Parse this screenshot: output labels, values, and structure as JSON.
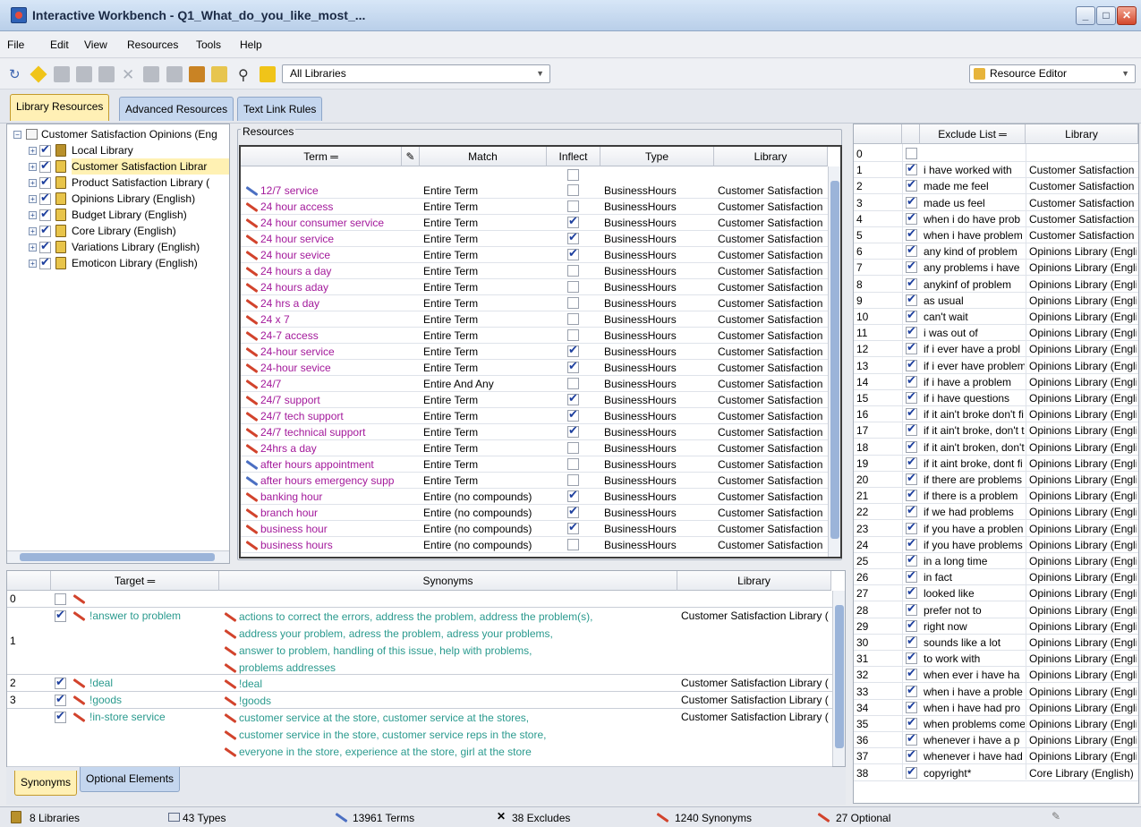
{
  "window": {
    "title": "Interactive Workbench - Q1_What_do_you_like_most_..."
  },
  "menu": [
    "File",
    "Edit",
    "View",
    "Resources",
    "Tools",
    "Help"
  ],
  "toolbar": {
    "library_filter": "All Libraries",
    "editor_select": "Resource Editor"
  },
  "main_tabs": [
    "Library Resources",
    "Advanced Resources",
    "Text Link Rules"
  ],
  "tree": {
    "root": "Customer Satisfaction Opinions (Eng",
    "items": [
      "Local Library",
      "Customer Satisfaction Librar",
      "Product Satisfaction Library (",
      "Opinions Library (English)",
      "Budget Library (English)",
      "Core Library (English)",
      "Variations Library (English)",
      "Emoticon Library (English)"
    ]
  },
  "resources": {
    "group_label": "Resources",
    "columns": [
      "Term",
      "Match",
      "Inflect",
      "Type",
      "Library"
    ],
    "rows": [
      {
        "term": "12/7 service",
        "match": "Entire Term",
        "inflect": false,
        "type": "BusinessHours",
        "library": "Customer Satisfaction",
        "icon": "blue"
      },
      {
        "term": "24 hour access",
        "match": "Entire Term",
        "inflect": false,
        "type": "BusinessHours",
        "library": "Customer Satisfaction",
        "icon": "red"
      },
      {
        "term": "24 hour consumer service",
        "match": "Entire Term",
        "inflect": true,
        "type": "BusinessHours",
        "library": "Customer Satisfaction",
        "icon": "red"
      },
      {
        "term": "24 hour service",
        "match": "Entire Term",
        "inflect": true,
        "type": "BusinessHours",
        "library": "Customer Satisfaction",
        "icon": "red"
      },
      {
        "term": "24 hour sevice",
        "match": "Entire Term",
        "inflect": true,
        "type": "BusinessHours",
        "library": "Customer Satisfaction",
        "icon": "red"
      },
      {
        "term": "24 hours a day",
        "match": "Entire Term",
        "inflect": false,
        "type": "BusinessHours",
        "library": "Customer Satisfaction",
        "icon": "red"
      },
      {
        "term": "24 hours aday",
        "match": "Entire Term",
        "inflect": false,
        "type": "BusinessHours",
        "library": "Customer Satisfaction",
        "icon": "red"
      },
      {
        "term": "24 hrs a day",
        "match": "Entire Term",
        "inflect": false,
        "type": "BusinessHours",
        "library": "Customer Satisfaction",
        "icon": "red"
      },
      {
        "term": "24 x 7",
        "match": "Entire Term",
        "inflect": false,
        "type": "BusinessHours",
        "library": "Customer Satisfaction",
        "icon": "red"
      },
      {
        "term": "24-7 access",
        "match": "Entire Term",
        "inflect": false,
        "type": "BusinessHours",
        "library": "Customer Satisfaction",
        "icon": "red"
      },
      {
        "term": "24-hour service",
        "match": "Entire Term",
        "inflect": true,
        "type": "BusinessHours",
        "library": "Customer Satisfaction",
        "icon": "red"
      },
      {
        "term": "24-hour sevice",
        "match": "Entire Term",
        "inflect": true,
        "type": "BusinessHours",
        "library": "Customer Satisfaction",
        "icon": "red"
      },
      {
        "term": "24/7",
        "match": "Entire And Any",
        "inflect": false,
        "type": "BusinessHours",
        "library": "Customer Satisfaction",
        "icon": "red"
      },
      {
        "term": "24/7 support",
        "match": "Entire Term",
        "inflect": true,
        "type": "BusinessHours",
        "library": "Customer Satisfaction",
        "icon": "red"
      },
      {
        "term": "24/7 tech support",
        "match": "Entire Term",
        "inflect": true,
        "type": "BusinessHours",
        "library": "Customer Satisfaction",
        "icon": "red"
      },
      {
        "term": "24/7 technical support",
        "match": "Entire Term",
        "inflect": true,
        "type": "BusinessHours",
        "library": "Customer Satisfaction",
        "icon": "red"
      },
      {
        "term": "24hrs a day",
        "match": "Entire Term",
        "inflect": false,
        "type": "BusinessHours",
        "library": "Customer Satisfaction",
        "icon": "red"
      },
      {
        "term": "after hours appointment",
        "match": "Entire Term",
        "inflect": false,
        "type": "BusinessHours",
        "library": "Customer Satisfaction",
        "icon": "blue"
      },
      {
        "term": "after hours emergency supp",
        "match": "Entire Term",
        "inflect": false,
        "type": "BusinessHours",
        "library": "Customer Satisfaction",
        "icon": "blue"
      },
      {
        "term": "banking hour",
        "match": "Entire (no compounds)",
        "inflect": true,
        "type": "BusinessHours",
        "library": "Customer Satisfaction",
        "icon": "red"
      },
      {
        "term": "branch hour",
        "match": "Entire (no compounds)",
        "inflect": true,
        "type": "BusinessHours",
        "library": "Customer Satisfaction",
        "icon": "red"
      },
      {
        "term": "business hour",
        "match": "Entire (no compounds)",
        "inflect": true,
        "type": "BusinessHours",
        "library": "Customer Satisfaction",
        "icon": "red"
      },
      {
        "term": "business hours",
        "match": "Entire (no compounds)",
        "inflect": false,
        "type": "BusinessHours",
        "library": "Customer Satisfaction",
        "icon": "red"
      }
    ]
  },
  "synonyms": {
    "columns": [
      "Target",
      "Synonyms",
      "Library"
    ],
    "rows": [
      {
        "num": "0",
        "target": "",
        "lines": [],
        "library": ""
      },
      {
        "num": "1",
        "target": "!answer to problem",
        "lines": [
          "actions to correct the errors,   address the problem,   address the problem(s),",
          "address your problem,   adress the problem,   adress your problems,",
          "answer to problem,   handling of this issue,   help with problems,",
          "problems addresses"
        ],
        "library": "Customer Satisfaction Library ("
      },
      {
        "num": "2",
        "target": "!deal",
        "lines": [
          "!deal"
        ],
        "library": "Customer Satisfaction Library ("
      },
      {
        "num": "3",
        "target": "!goods",
        "lines": [
          "!goods"
        ],
        "library": "Customer Satisfaction Library ("
      },
      {
        "num": "",
        "target": "!in-store service",
        "lines": [
          "customer service at the store,   customer service at the stores,",
          "customer service in the store,   customer service reps in the store,",
          "everyone in the store,   experience at the store,   girl at the store"
        ],
        "library": "Customer Satisfaction Library ("
      }
    ]
  },
  "bottom_tabs": [
    "Synonyms",
    "Optional Elements"
  ],
  "exclude": {
    "columns": [
      "Exclude List",
      "Library"
    ],
    "rows": [
      {
        "n": "0",
        "text": "",
        "lib": "",
        "on": false
      },
      {
        "n": "1",
        "text": "i have worked with",
        "lib": "Customer Satisfaction",
        "on": true
      },
      {
        "n": "2",
        "text": "made me feel",
        "lib": "Customer Satisfaction",
        "on": true
      },
      {
        "n": "3",
        "text": "made us feel",
        "lib": "Customer Satisfaction",
        "on": true
      },
      {
        "n": "4",
        "text": "when i do have prob",
        "lib": "Customer Satisfaction",
        "on": true
      },
      {
        "n": "5",
        "text": "when i have problem",
        "lib": "Customer Satisfaction",
        "on": true
      },
      {
        "n": "6",
        "text": "any kind of problem",
        "lib": "Opinions Library (Engli",
        "on": true
      },
      {
        "n": "7",
        "text": "any problems i have",
        "lib": "Opinions Library (Engli",
        "on": true
      },
      {
        "n": "8",
        "text": "anykinf of problem",
        "lib": "Opinions Library (Engli",
        "on": true
      },
      {
        "n": "9",
        "text": "as usual",
        "lib": "Opinions Library (Engli",
        "on": true
      },
      {
        "n": "10",
        "text": "can't wait",
        "lib": "Opinions Library (Engli",
        "on": true
      },
      {
        "n": "11",
        "text": "i was out of",
        "lib": "Opinions Library (Engli",
        "on": true
      },
      {
        "n": "12",
        "text": "if i ever have a probl",
        "lib": "Opinions Library (Engli",
        "on": true
      },
      {
        "n": "13",
        "text": "if i ever have problem",
        "lib": "Opinions Library (Engli",
        "on": true
      },
      {
        "n": "14",
        "text": "if i have a problem",
        "lib": "Opinions Library (Engli",
        "on": true
      },
      {
        "n": "15",
        "text": "if i have questions",
        "lib": "Opinions Library (Engli",
        "on": true
      },
      {
        "n": "16",
        "text": "if it ain't broke don't fi",
        "lib": "Opinions Library (Engli",
        "on": true
      },
      {
        "n": "17",
        "text": "if it ain't broke, don't t",
        "lib": "Opinions Library (Engli",
        "on": true
      },
      {
        "n": "18",
        "text": "if it ain't broken, don't",
        "lib": "Opinions Library (Engli",
        "on": true
      },
      {
        "n": "19",
        "text": "if it aint broke, dont fi",
        "lib": "Opinions Library (Engli",
        "on": true
      },
      {
        "n": "20",
        "text": "if there are problems",
        "lib": "Opinions Library (Engli",
        "on": true
      },
      {
        "n": "21",
        "text": "if there is a problem",
        "lib": "Opinions Library (Engli",
        "on": true
      },
      {
        "n": "22",
        "text": "if we had problems",
        "lib": "Opinions Library (Engli",
        "on": true
      },
      {
        "n": "23",
        "text": "if you have a problen",
        "lib": "Opinions Library (Engli",
        "on": true
      },
      {
        "n": "24",
        "text": "if you have problems",
        "lib": "Opinions Library (Engli",
        "on": true
      },
      {
        "n": "25",
        "text": "in a long time",
        "lib": "Opinions Library (Engli",
        "on": true
      },
      {
        "n": "26",
        "text": "in fact",
        "lib": "Opinions Library (Engli",
        "on": true
      },
      {
        "n": "27",
        "text": "looked like",
        "lib": "Opinions Library (Engli",
        "on": true
      },
      {
        "n": "28",
        "text": "prefer not to",
        "lib": "Opinions Library (Engli",
        "on": true
      },
      {
        "n": "29",
        "text": "right now",
        "lib": "Opinions Library (Engli",
        "on": true
      },
      {
        "n": "30",
        "text": "sounds like a lot",
        "lib": "Opinions Library (Engli",
        "on": true
      },
      {
        "n": "31",
        "text": "to work with",
        "lib": "Opinions Library (Engli",
        "on": true
      },
      {
        "n": "32",
        "text": "when ever i have ha",
        "lib": "Opinions Library (Engli",
        "on": true
      },
      {
        "n": "33",
        "text": "when i have a proble",
        "lib": "Opinions Library (Engli",
        "on": true
      },
      {
        "n": "34",
        "text": "when i have had pro",
        "lib": "Opinions Library (Engli",
        "on": true
      },
      {
        "n": "35",
        "text": "when problems come",
        "lib": "Opinions Library (Engli",
        "on": true
      },
      {
        "n": "36",
        "text": "whenever i have a p",
        "lib": "Opinions Library (Engli",
        "on": true
      },
      {
        "n": "37",
        "text": "whenever i have had",
        "lib": "Opinions Library (Engli",
        "on": true
      },
      {
        "n": "38",
        "text": "copyright*",
        "lib": "Core Library (English)",
        "on": true
      }
    ]
  },
  "status": {
    "libraries": "8 Libraries",
    "types": "43 Types",
    "terms": "13961 Terms",
    "excludes": "38 Excludes",
    "synonyms": "1240 Synonyms",
    "optional": "27 Optional"
  },
  "colors": {
    "term_text": "#a3199b",
    "synonym_text": "#2a9a8e",
    "active_tab": "#fff0b5",
    "inactive_tab": "#c4d6ee"
  }
}
